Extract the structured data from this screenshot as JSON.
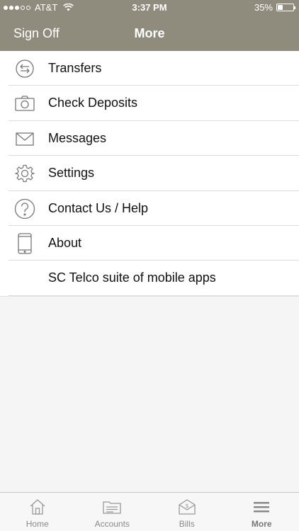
{
  "status_bar": {
    "carrier": "AT&T",
    "time": "3:37 PM",
    "battery": "35%",
    "battery_level": 0.35,
    "signal_bars": 3,
    "signal_total": 5
  },
  "nav": {
    "left_button": "Sign Off",
    "title": "More"
  },
  "menu": {
    "items": [
      {
        "label": "Transfers",
        "icon": "transfer-icon"
      },
      {
        "label": "Check Deposits",
        "icon": "camera-icon"
      },
      {
        "label": "Messages",
        "icon": "envelope-icon"
      },
      {
        "label": "Settings",
        "icon": "gear-icon"
      },
      {
        "label": "Contact Us / Help",
        "icon": "question-icon"
      },
      {
        "label": "About",
        "icon": "phone-icon"
      },
      {
        "label": "SC Telco suite of mobile apps",
        "icon": ""
      }
    ]
  },
  "tabs": [
    {
      "label": "Home",
      "icon": "home-icon",
      "active": false
    },
    {
      "label": "Accounts",
      "icon": "accounts-icon",
      "active": false
    },
    {
      "label": "Bills",
      "icon": "bills-icon",
      "active": false
    },
    {
      "label": "More",
      "icon": "menu-icon",
      "active": true
    }
  ],
  "colors": {
    "header": "#8f8b7d",
    "icon": "#777777",
    "tab_icon": "#999999"
  }
}
